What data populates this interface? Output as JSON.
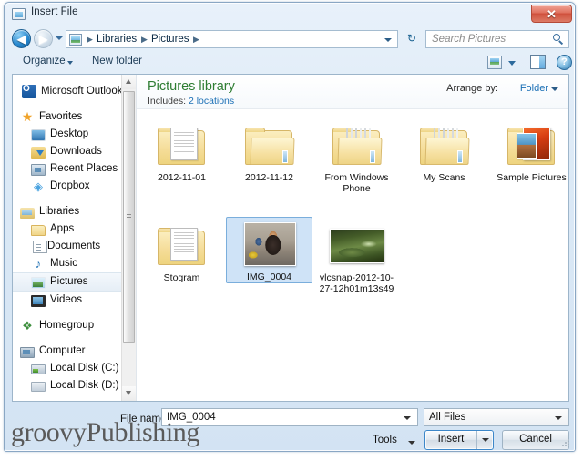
{
  "window": {
    "title": "Insert File",
    "title_icon": "file-window-icon",
    "close_label": "✕"
  },
  "address_bar": {
    "back_icon": "back-arrow-icon",
    "forward_icon": "forward-arrow-icon",
    "back_glyph": "◀",
    "forward_glyph": "▶",
    "location_icon": "pictures-library-icon",
    "breadcrumbs": [
      "Libraries",
      "Pictures"
    ],
    "separator": "▶",
    "refresh_glyph": "↻",
    "search": {
      "placeholder": "Search Pictures",
      "icon": "search-icon"
    }
  },
  "toolbar": {
    "organize_label": "Organize",
    "new_folder_label": "New folder",
    "view_icon": "view-layout-icon",
    "preview_pane_icon": "preview-pane-icon",
    "help_icon": "help-icon",
    "help_glyph": "?"
  },
  "sidebar": {
    "items": [
      {
        "label": "Microsoft Outlook",
        "icon": "outlook-icon",
        "icon_class": "ic-outlook",
        "indent": 10,
        "type": "header",
        "selected": false
      },
      {
        "label": "Favorites",
        "icon": "star-icon",
        "icon_class": "ic-star",
        "indent": 8,
        "type": "header",
        "selected": false,
        "glyph": "★"
      },
      {
        "label": "Desktop",
        "icon": "desktop-icon",
        "icon_class": "ic-desktop",
        "indent": 20,
        "type": "item",
        "selected": false
      },
      {
        "label": "Downloads",
        "icon": "downloads-icon",
        "icon_class": "ic-download",
        "indent": 20,
        "type": "item",
        "selected": false
      },
      {
        "label": "Recent Places",
        "icon": "recent-places-icon",
        "icon_class": "ic-recent",
        "indent": 20,
        "type": "item",
        "selected": false
      },
      {
        "label": "Dropbox",
        "icon": "dropbox-icon",
        "icon_class": "ic-dropbox",
        "indent": 20,
        "type": "item",
        "selected": false,
        "glyph": "◈"
      },
      {
        "label": "Libraries",
        "icon": "libraries-icon",
        "icon_class": "ic-libraries",
        "indent": 8,
        "type": "header",
        "selected": false
      },
      {
        "label": "Apps",
        "icon": "folder-icon",
        "icon_class": "ic-folder-y",
        "indent": 20,
        "type": "item",
        "selected": false
      },
      {
        "label": "Documents",
        "icon": "documents-icon",
        "icon_class": "ic-doc",
        "indent": 20,
        "type": "item",
        "selected": false
      },
      {
        "label": "Music",
        "icon": "music-icon",
        "icon_class": "ic-music",
        "indent": 20,
        "type": "item",
        "selected": false,
        "glyph": "♪"
      },
      {
        "label": "Pictures",
        "icon": "pictures-icon",
        "icon_class": "ic-pictures",
        "indent": 20,
        "type": "item",
        "selected": true
      },
      {
        "label": "Videos",
        "icon": "videos-icon",
        "icon_class": "ic-video",
        "indent": 20,
        "type": "item",
        "selected": false
      },
      {
        "label": "Homegroup",
        "icon": "homegroup-icon",
        "icon_class": "ic-homegroup",
        "indent": 8,
        "type": "header",
        "selected": false,
        "glyph": "❖"
      },
      {
        "label": "Computer",
        "icon": "computer-icon",
        "icon_class": "ic-computer",
        "indent": 8,
        "type": "header",
        "selected": false
      },
      {
        "label": "Local Disk (C:)",
        "icon": "local-disk-icon",
        "icon_class": "ic-disk",
        "indent": 20,
        "type": "item",
        "selected": false
      },
      {
        "label": "Local Disk (D:)",
        "icon": "local-disk-icon",
        "icon_class": "ic-disk-plain",
        "indent": 20,
        "type": "item",
        "selected": false
      }
    ],
    "scrollbar": {
      "up_icon": "scroll-up-icon",
      "down_icon": "scroll-down-icon"
    }
  },
  "library_header": {
    "title": "Pictures library",
    "includes_label": "Includes:",
    "includes_value": "2 locations",
    "arrange_label": "Arrange by:",
    "arrange_value": "Folder"
  },
  "files": [
    {
      "name": "2012-11-01",
      "type": "folder-documents",
      "selected": false
    },
    {
      "name": "2012-11-12",
      "type": "folder-empty",
      "selected": false
    },
    {
      "name": "From Windows Phone",
      "type": "folder-stack",
      "selected": false
    },
    {
      "name": "My Scans",
      "type": "folder-stack",
      "selected": false
    },
    {
      "name": "Sample Pictures",
      "type": "folder-photos",
      "selected": false
    },
    {
      "name": "Stogram",
      "type": "folder-documents",
      "selected": false
    },
    {
      "name": "IMG_0004",
      "type": "image",
      "selected": true
    },
    {
      "name": "vlcsnap-2012-10-27-12h01m13s49",
      "type": "image",
      "selected": false
    }
  ],
  "footer": {
    "file_name_label": "File name:",
    "file_name_value": "IMG_0004",
    "file_type_value": "All Files",
    "tools_label": "Tools",
    "insert_label": "Insert",
    "cancel_label": "Cancel"
  },
  "watermark": {
    "text": "groovyPublishing"
  },
  "colors": {
    "accent": "#1a6fb5",
    "library_title": "#2e7d32",
    "selection": "#cfe3f7",
    "selection_border": "#7aaedc",
    "close_button": "#cf503c",
    "frame": "#8aa7c4"
  }
}
